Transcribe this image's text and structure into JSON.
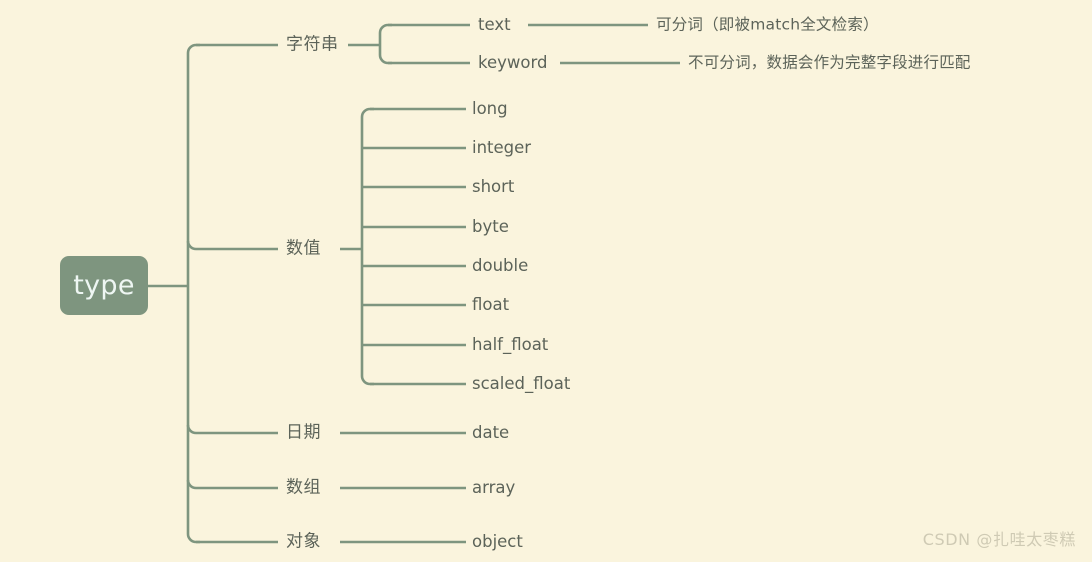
{
  "diagram": {
    "type": "mindmap",
    "background_color": "#faf4dd",
    "line_color": "#7e957f",
    "text_color": "#5c6359",
    "root": {
      "label": "type",
      "fill_color": "#7e957f",
      "text_color": "#eef6f3"
    },
    "branches": [
      {
        "label": "字符串",
        "children": [
          {
            "label": "text",
            "note": "可分词（即被match全文检索）"
          },
          {
            "label": "keyword",
            "note": "不可分词，数据会作为完整字段进行匹配"
          }
        ]
      },
      {
        "label": "数值",
        "children": [
          {
            "label": "long"
          },
          {
            "label": "integer"
          },
          {
            "label": "short"
          },
          {
            "label": "byte"
          },
          {
            "label": "double"
          },
          {
            "label": "float"
          },
          {
            "label": "half_float"
          },
          {
            "label": "scaled_float"
          }
        ]
      },
      {
        "label": "日期",
        "children": [
          {
            "label": "date"
          }
        ]
      },
      {
        "label": "数组",
        "children": [
          {
            "label": "array"
          }
        ]
      },
      {
        "label": "对象",
        "children": [
          {
            "label": "object"
          }
        ]
      }
    ]
  },
  "watermark": {
    "text": "CSDN @扎哇太枣糕"
  }
}
